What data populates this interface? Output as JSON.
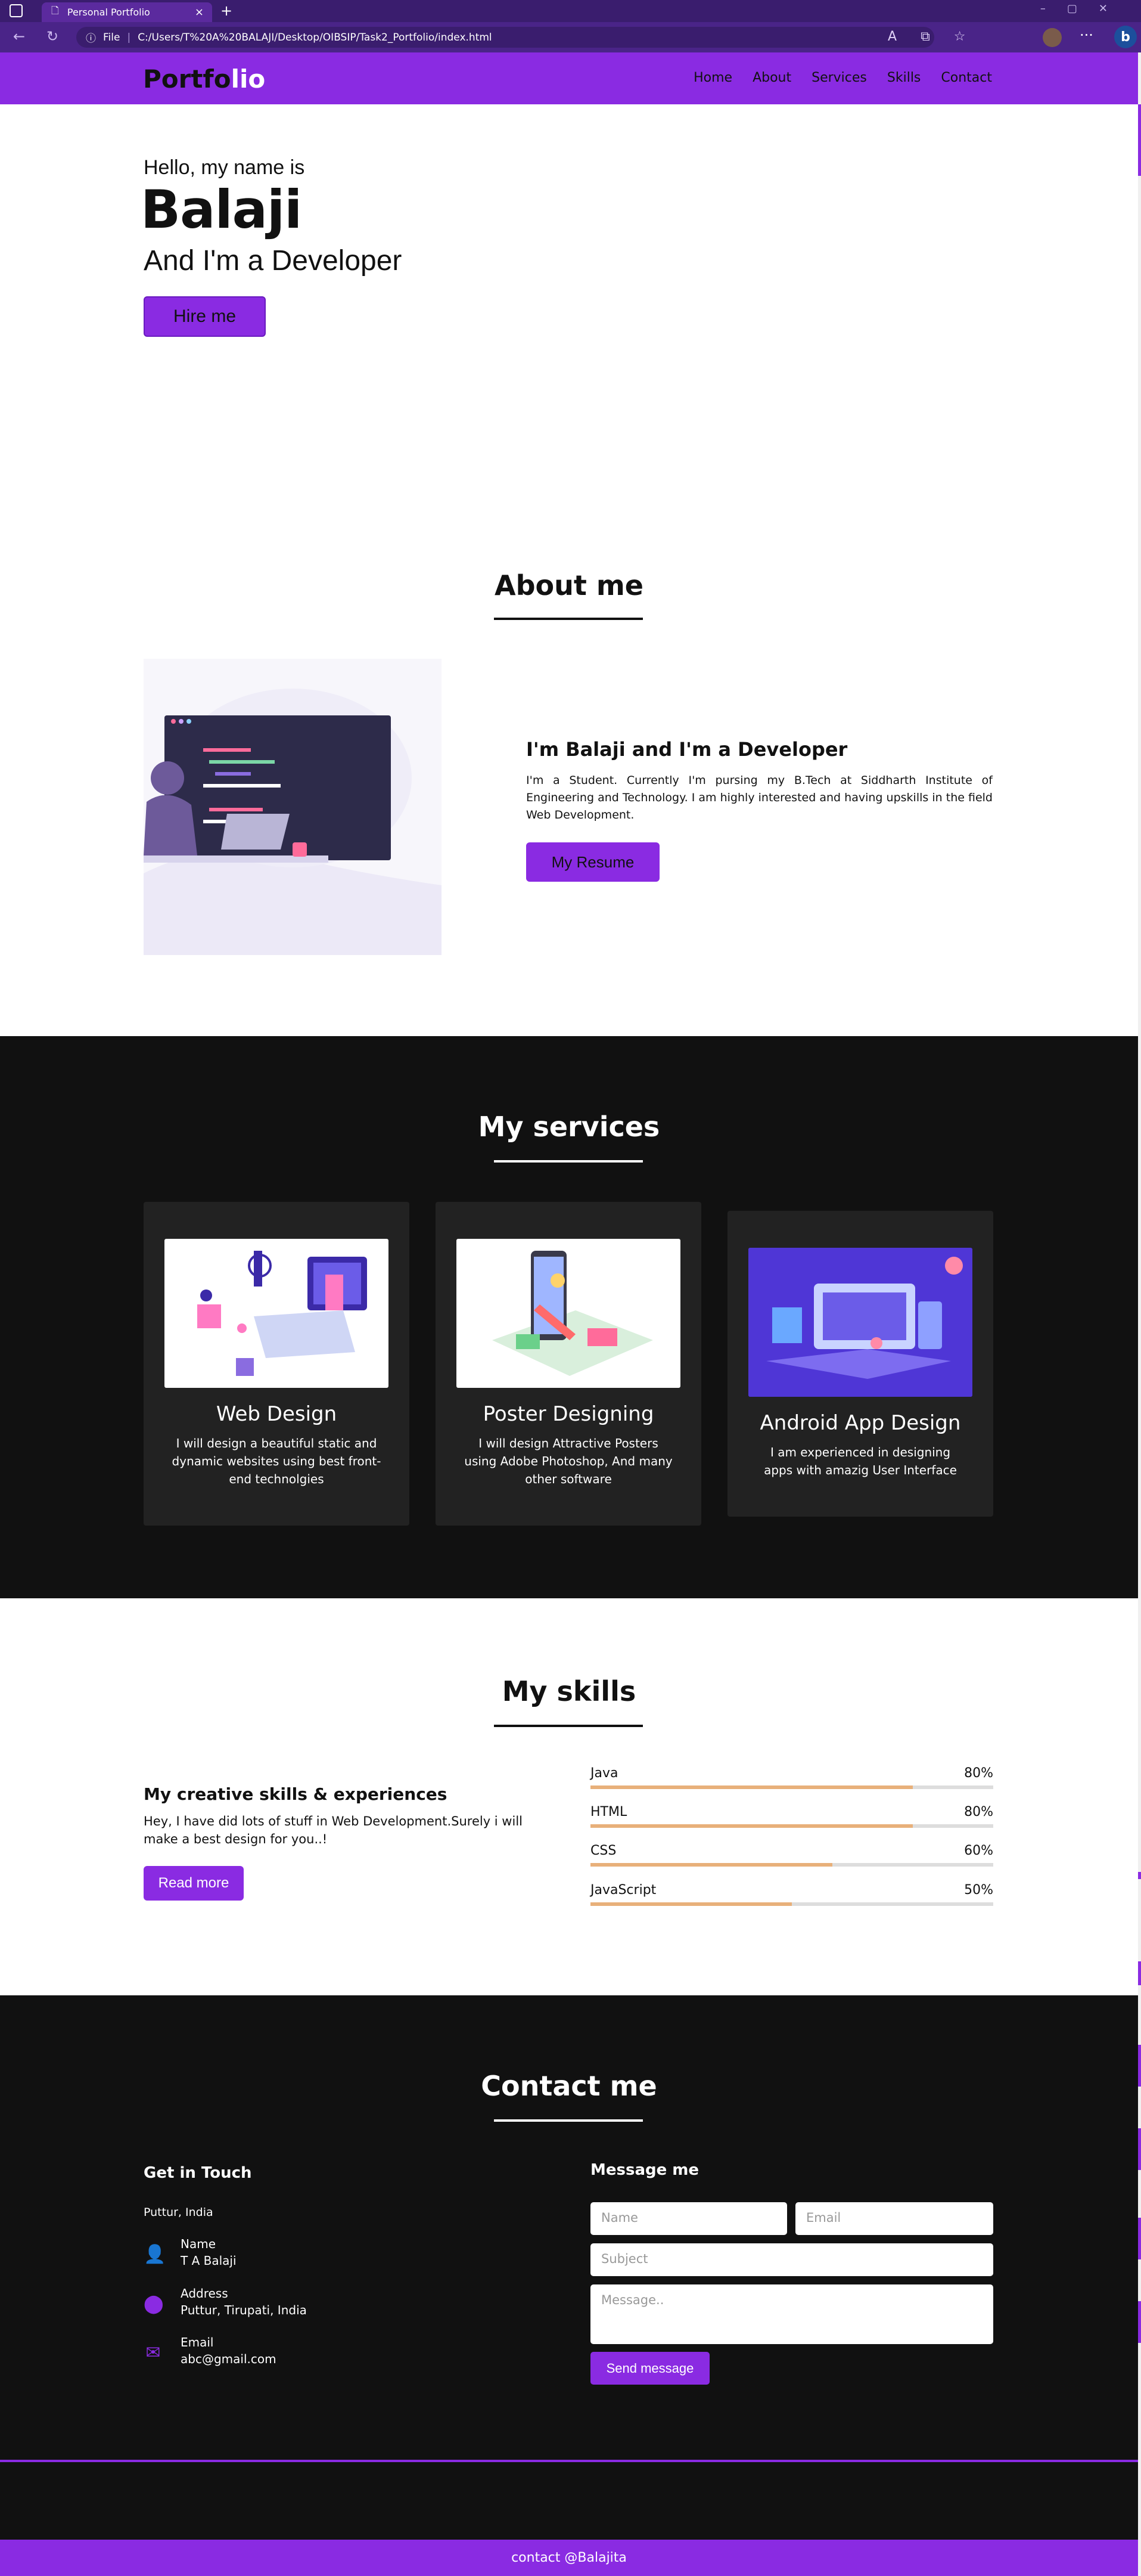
{
  "browser": {
    "tab_title": "Personal Portfolio",
    "tab_close": "×",
    "new_tab": "+",
    "url_prefix": "File",
    "url": "C:/Users/T%20A%20BALAJI/Desktop/OIBSIP/Task2_Portfolio/index.html",
    "menu": "···",
    "bing": "b"
  },
  "nav": {
    "logo_a": "Portfo",
    "logo_b": "lio",
    "items": [
      "Home",
      "About",
      "Services",
      "Skills",
      "Contact"
    ]
  },
  "hero": {
    "greeting": "Hello, my name is",
    "name": "Balaji",
    "role": "And I'm a Developer",
    "button": "Hire me"
  },
  "about": {
    "title": "About me",
    "heading": "I'm Balaji and I'm a Developer",
    "text": "I'm a Student. Currently I'm pursing my B.Tech at Siddharth Institute of Engineering and Technology. I am highly interested and having upskills in the field Web Development.",
    "button": "My Resume"
  },
  "services": {
    "title": "My services",
    "cards": [
      {
        "title": "Web Design",
        "text": "I will design a beautiful static and dynamic websites using best front-end technolgies"
      },
      {
        "title": "Poster Designing",
        "text": "I will design Attractive Posters using Adobe Photoshop, And many other software"
      },
      {
        "title": "Android App Design",
        "text": "I am experienced in designing apps with amazig User Interface"
      }
    ]
  },
  "skills": {
    "title": "My skills",
    "heading": "My creative skills & experiences",
    "text": "Hey, I have did lots of stuff in Web Development.Surely i will make a best design for you..!",
    "button": "Read more",
    "bars": [
      {
        "name": "Java",
        "label": "80%",
        "value": 0.8
      },
      {
        "name": "HTML",
        "label": "80%",
        "value": 0.8
      },
      {
        "name": "CSS",
        "label": "60%",
        "value": 0.6
      },
      {
        "name": "JavaScript",
        "label": "50%",
        "value": 0.5
      }
    ]
  },
  "contact": {
    "title": "Contact me",
    "left_heading": "Get in Touch",
    "city": "Puttur, India",
    "items": [
      {
        "key": "Name",
        "value": "T A Balaji",
        "icon": "user-icon"
      },
      {
        "key": "Address",
        "value": "Puttur, Tirupati, India",
        "icon": "map-marker-icon"
      },
      {
        "key": "Email",
        "value": "abc@gmail.com",
        "icon": "envelope-icon"
      }
    ],
    "right_heading": "Message me",
    "placeholders": {
      "name": "Name",
      "email": "Email",
      "subject": "Subject",
      "message": "Message.."
    },
    "button": "Send message"
  },
  "footer": {
    "text": "contact @Balajita"
  },
  "colors": {
    "accent": "#8a2be2",
    "dark": "#111111",
    "card": "#222222",
    "bar": "#e8b07a"
  }
}
